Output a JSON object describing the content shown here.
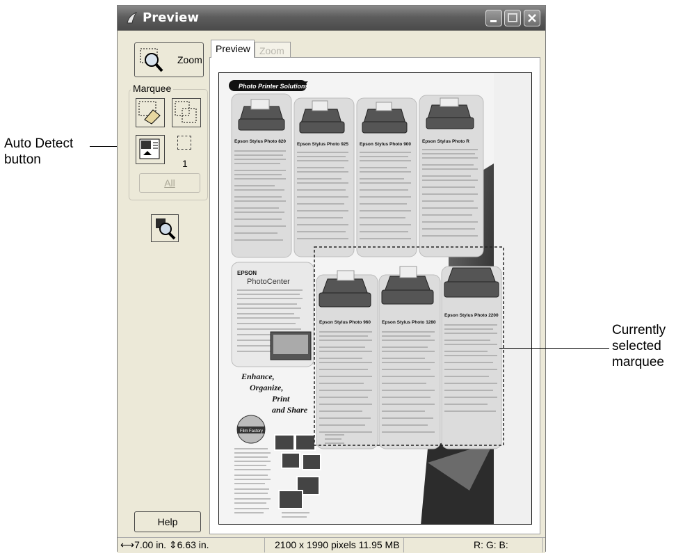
{
  "window": {
    "title": "Preview"
  },
  "callouts": {
    "auto_detect": "Auto Detect\nbutton",
    "current_marquee": "Currently\nselected\nmarquee"
  },
  "left_panel": {
    "zoom_label": "Zoom",
    "marquee_label": "Marquee",
    "marquee_count": "1",
    "all_label": "All",
    "help_label": "Help"
  },
  "tabs": [
    {
      "label": "Preview",
      "active": true
    },
    {
      "label": "Zoom",
      "active": false
    }
  ],
  "status": {
    "width": "7.00 in.",
    "height": "6.63 in.",
    "pixels": "2100 x 1990 pixels 11.95 MB",
    "rgb": "R: G: B:"
  },
  "brochure": {
    "banner": "Photo Printer Solutions",
    "products": [
      "Epson Stylus Photo 820",
      "Epson Stylus Photo 925",
      "Epson Stylus Photo 900",
      "Epson Stylus Photo R",
      "Epson Stylus Photo 960",
      "Epson Stylus Photo 1280",
      "Epson Stylus Photo 2200"
    ],
    "brand": "EPSON",
    "photocenter": "PhotoCenter",
    "slogan_lines": [
      "Enhance,",
      "Organize,",
      "Print",
      "and Share"
    ],
    "seal": "Film Factory"
  },
  "colors": {
    "titlebar": "#5d5d5d",
    "panel": "#ece9d8"
  }
}
